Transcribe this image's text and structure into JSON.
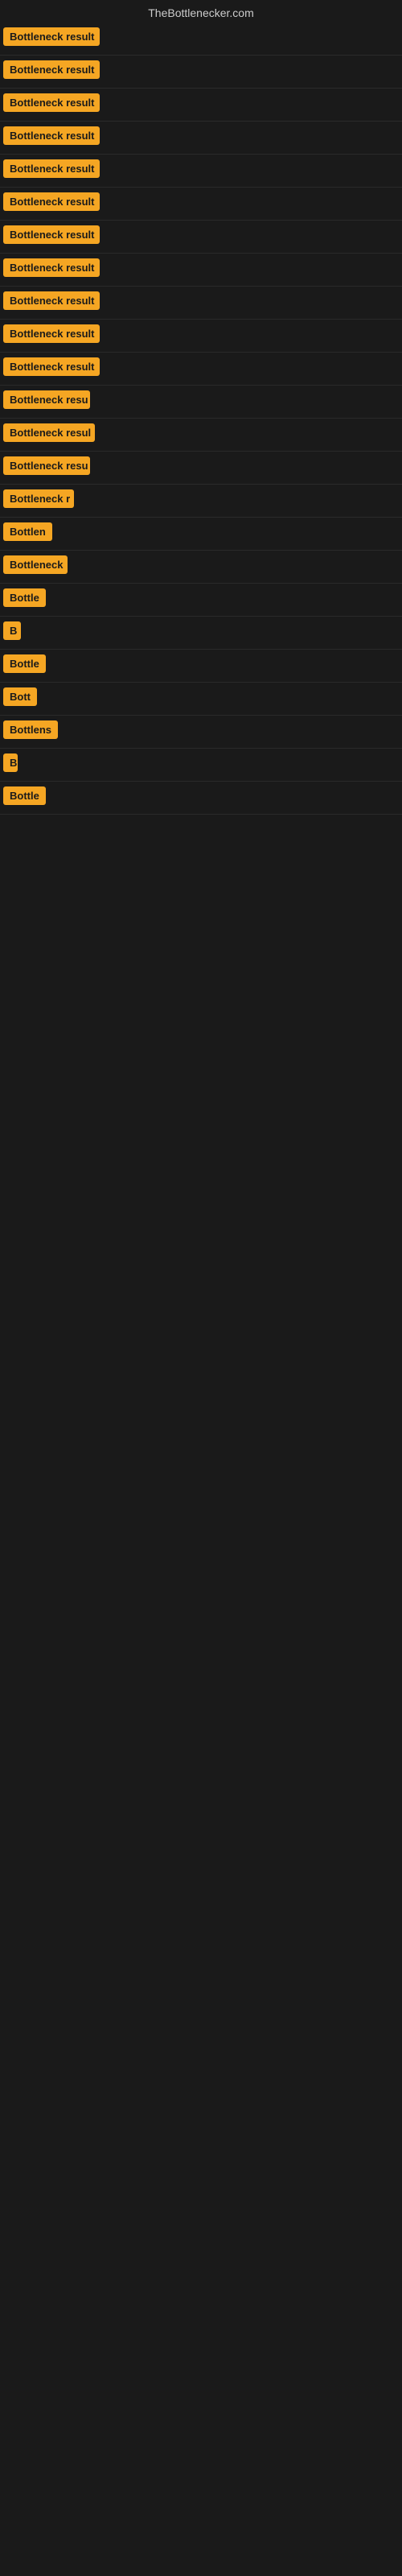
{
  "site": {
    "title": "TheBottlenecker.com"
  },
  "rows": [
    {
      "id": 1,
      "label": "Bottleneck result",
      "width": 120
    },
    {
      "id": 2,
      "label": "Bottleneck result",
      "width": 120
    },
    {
      "id": 3,
      "label": "Bottleneck result",
      "width": 120
    },
    {
      "id": 4,
      "label": "Bottleneck result",
      "width": 120
    },
    {
      "id": 5,
      "label": "Bottleneck result",
      "width": 120
    },
    {
      "id": 6,
      "label": "Bottleneck result",
      "width": 120
    },
    {
      "id": 7,
      "label": "Bottleneck result",
      "width": 120
    },
    {
      "id": 8,
      "label": "Bottleneck result",
      "width": 120
    },
    {
      "id": 9,
      "label": "Bottleneck result",
      "width": 120
    },
    {
      "id": 10,
      "label": "Bottleneck result",
      "width": 120
    },
    {
      "id": 11,
      "label": "Bottleneck result",
      "width": 120
    },
    {
      "id": 12,
      "label": "Bottleneck resu",
      "width": 108
    },
    {
      "id": 13,
      "label": "Bottleneck resul",
      "width": 114
    },
    {
      "id": 14,
      "label": "Bottleneck resu",
      "width": 108
    },
    {
      "id": 15,
      "label": "Bottleneck r",
      "width": 88
    },
    {
      "id": 16,
      "label": "Bottlen",
      "width": 66
    },
    {
      "id": 17,
      "label": "Bottleneck",
      "width": 80
    },
    {
      "id": 18,
      "label": "Bottle",
      "width": 56
    },
    {
      "id": 19,
      "label": "B",
      "width": 22
    },
    {
      "id": 20,
      "label": "Bottle",
      "width": 56
    },
    {
      "id": 21,
      "label": "Bott",
      "width": 46
    },
    {
      "id": 22,
      "label": "Bottlens",
      "width": 70
    },
    {
      "id": 23,
      "label": "B",
      "width": 18
    },
    {
      "id": 24,
      "label": "Bottle",
      "width": 56
    }
  ]
}
